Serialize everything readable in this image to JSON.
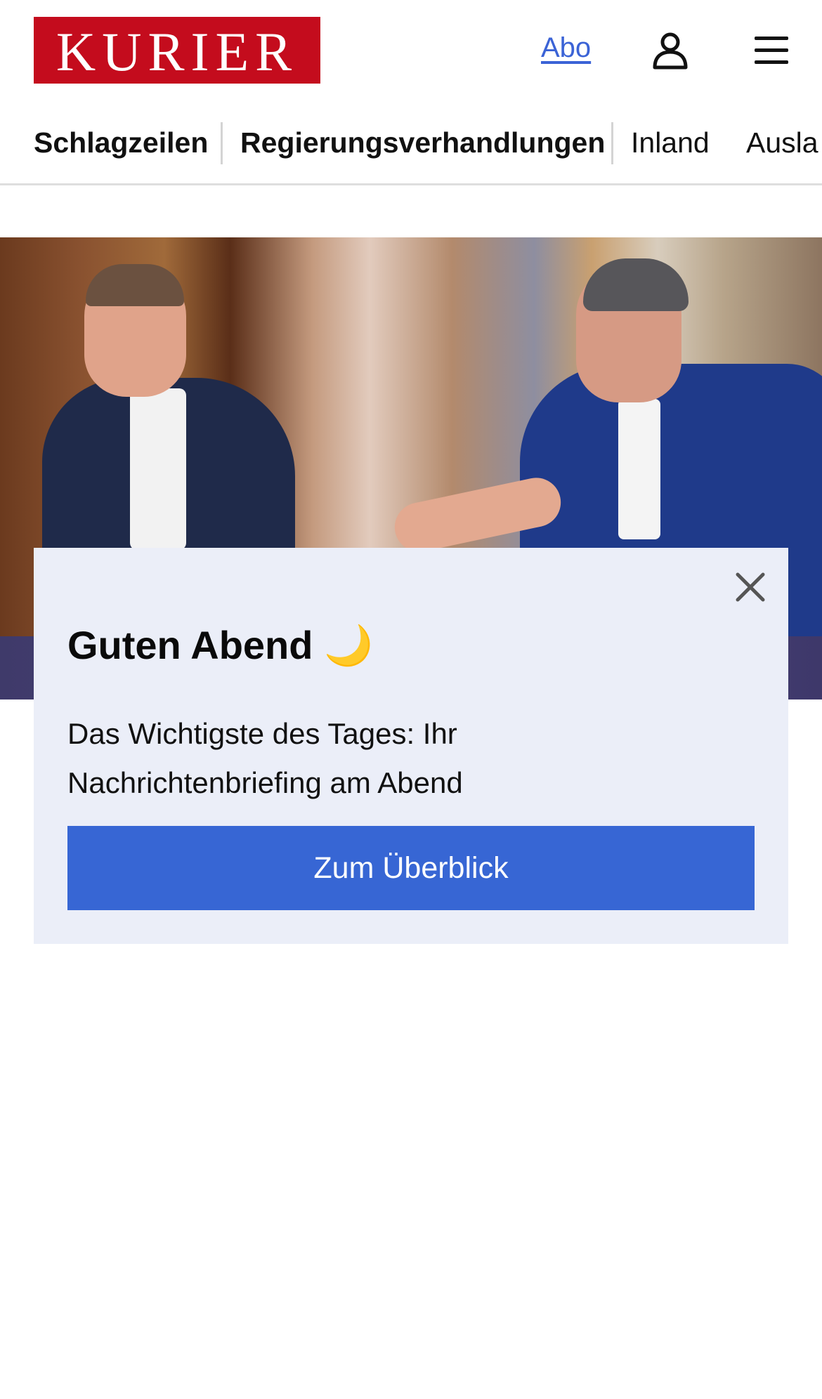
{
  "header": {
    "logo_text": "KURIER",
    "abo_label": "Abo",
    "user_icon": "user-icon",
    "menu_icon": "hamburger-menu-icon",
    "brand_color": "#c40c1d",
    "link_color": "#3b63d6"
  },
  "nav": {
    "items": [
      {
        "label": "Schlagzeilen"
      },
      {
        "label": "Regierungsverhandlungen"
      },
      {
        "label": "Inland"
      },
      {
        "label": "Ausla"
      }
    ]
  },
  "hero": {
    "image_alt": ""
  },
  "popup": {
    "title": "Guten Abend 🌙",
    "text": "Das Wichtigste des Tages: Ihr Nachrichtenbriefing am Abend",
    "cta_label": "Zum Überblick",
    "close_icon": "close-icon",
    "cta_color": "#3766d4",
    "background": "#ebeef8"
  }
}
